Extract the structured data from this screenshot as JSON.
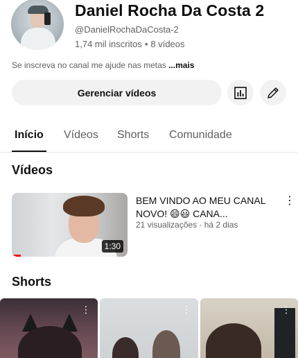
{
  "channel": {
    "name": "Daniel Rocha Da Costa 2",
    "handle": "@DanielRochaDaCosta-2",
    "subscribers": "1,74 mil inscritos",
    "separator": "•",
    "videos_count": "8 vídeos",
    "description": "Se inscreva no canal me ajude nas metas ",
    "more_label": "...mais"
  },
  "actions": {
    "manage_label": "Gerenciar vídeos",
    "analytics_icon": "bar-chart-icon",
    "edit_icon": "pencil-icon"
  },
  "tabs": [
    {
      "label": "Início",
      "active": true
    },
    {
      "label": "Vídeos",
      "active": false
    },
    {
      "label": "Shorts",
      "active": false
    },
    {
      "label": "Comunidade",
      "active": false
    }
  ],
  "sections": {
    "videos_title": "Vídeos",
    "shorts_title": "Shorts"
  },
  "video": {
    "title": "BEM VINDO AO MEU CANAL NOVO! 😄😃 CANA...",
    "meta": "21 visualizações · há 2 dias",
    "duration": "1:30",
    "watched_fraction": 0.08
  },
  "shorts_menu_glyph": "⋮",
  "colors": {
    "text_primary": "#0f0f0f",
    "text_secondary": "#606060",
    "button_bg": "#f2f2f2",
    "progress": "#ff0000"
  }
}
